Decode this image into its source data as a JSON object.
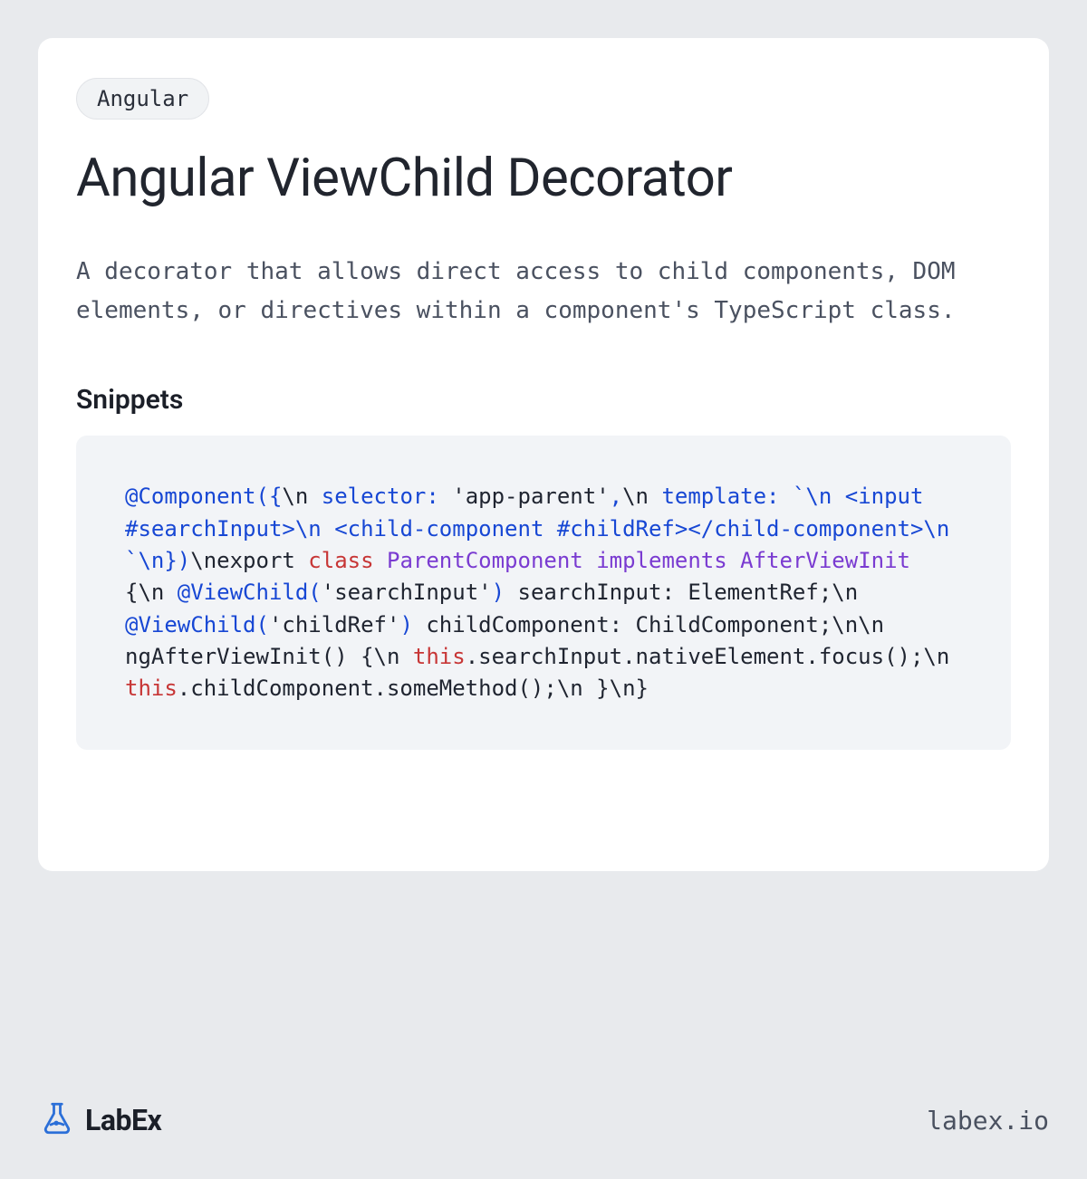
{
  "tag": "Angular",
  "title": "Angular ViewChild Decorator",
  "description": "A decorator that allows direct access to child components, DOM elements, or directives within a component's TypeScript class.",
  "section_heading": "Snippets",
  "code_tokens": [
    {
      "t": "@Component({",
      "c": "tok-decorator"
    },
    {
      "t": "\\n  ",
      "c": ""
    },
    {
      "t": "selector:",
      "c": "tok-sel"
    },
    {
      "t": " ",
      "c": ""
    },
    {
      "t": "'app-parent'",
      "c": "tok-str"
    },
    {
      "t": ",",
      "c": "tok-punct"
    },
    {
      "t": "\\n  ",
      "c": ""
    },
    {
      "t": "template:",
      "c": "tok-sel"
    },
    {
      "t": " ",
      "c": ""
    },
    {
      "t": "`\\n    ",
      "c": "tok-punct"
    },
    {
      "t": "<input #searchInput>",
      "c": "tok-tag"
    },
    {
      "t": "\\n    ",
      "c": "tok-punct"
    },
    {
      "t": "<child-component #childRef></child-component>",
      "c": "tok-tag"
    },
    {
      "t": "\\n  `",
      "c": "tok-punct"
    },
    {
      "t": "\\n})",
      "c": "tok-decorator"
    },
    {
      "t": "\\nexport ",
      "c": ""
    },
    {
      "t": "class",
      "c": "tok-kw"
    },
    {
      "t": " ",
      "c": ""
    },
    {
      "t": "ParentComponent",
      "c": "tok-cls"
    },
    {
      "t": " ",
      "c": ""
    },
    {
      "t": "implements",
      "c": "tok-impl"
    },
    {
      "t": " ",
      "c": ""
    },
    {
      "t": "AfterViewInit",
      "c": "tok-cls"
    },
    {
      "t": " {\\n  ",
      "c": ""
    },
    {
      "t": "@ViewChild(",
      "c": "tok-decorator"
    },
    {
      "t": "'searchInput'",
      "c": "tok-str"
    },
    {
      "t": ")",
      "c": "tok-decorator"
    },
    {
      "t": " searchInput: ElementRef;\\n  ",
      "c": ""
    },
    {
      "t": "@ViewChild(",
      "c": "tok-decorator"
    },
    {
      "t": "'childRef'",
      "c": "tok-str"
    },
    {
      "t": ")",
      "c": "tok-decorator"
    },
    {
      "t": " childComponent: ChildComponent;\\n\\n  ngAfterViewInit() {\\n    ",
      "c": ""
    },
    {
      "t": "this",
      "c": "tok-this"
    },
    {
      "t": ".searchInput.nativeElement.focus();\\n    ",
      "c": ""
    },
    {
      "t": "this",
      "c": "tok-this"
    },
    {
      "t": ".childComponent.someMethod();\\n  }\\n}",
      "c": ""
    }
  ],
  "footer": {
    "brand": "LabEx",
    "site": "labex.io"
  }
}
